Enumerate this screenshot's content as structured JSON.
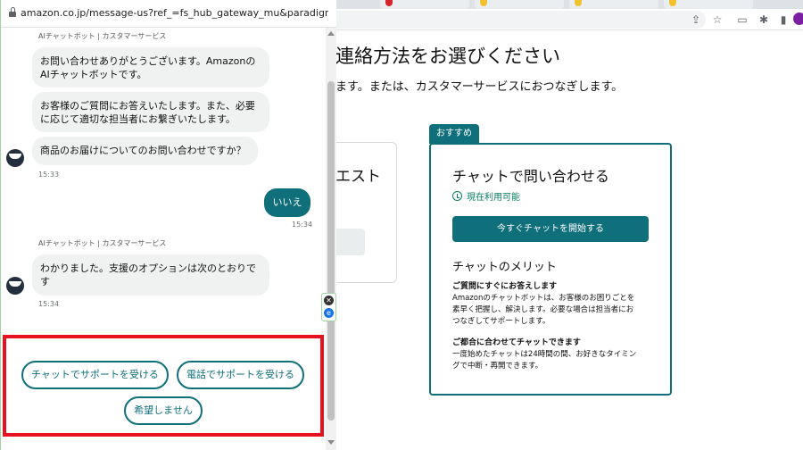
{
  "popup": {
    "url": "amazon.co.jp/message-us?ref_=fs_hub_gateway_mu&paradigm=foresig..."
  },
  "chat": {
    "bot_name": "AIチャットボット | カスタマーサービス",
    "greeting_1": "お問い合わせありがとうございます。Amazonの\nAIチャットボットです。",
    "greeting_2": "お客様のご質問にお答えいたします。また、必要\nに応じて適切な担当者にお繋ぎいたします。",
    "question": "商品のお届けについてのお問い合わせですか？",
    "time_1": "15:33",
    "user_reply": "いいえ",
    "user_time": "15:34",
    "bot_name_2": "AIチャットボット | カスタマーサービス",
    "reply": "わかりました。支援のオプションは次のとおりで\nす",
    "time_2": "15:34",
    "options": [
      "チャットでサポートを受ける",
      "電話でサポートを受ける",
      "希望しません"
    ]
  },
  "background": {
    "heading": "連絡方法をお選びください",
    "sub": "ます。または、カスタマーサービスにおつなぎします。",
    "left_card_title": "エスト",
    "recommend_tag": "おすすめ",
    "chat_card": {
      "title": "チャットで問い合わせる",
      "availability": "現在利用可能",
      "start_button": "今すぐチャットを開始する",
      "merit_title": "チャットのメリット",
      "merit_1_title": "ご質問にすぐにお答えします",
      "merit_1_text": "Amazonのチャットボットは、お客様のお困りごとを\n素早く把握し、解決します。必要な場合は担当者にお\nつなぎしてサポートします。",
      "merit_2_title": "ご都合に合わせてチャットできます",
      "merit_2_text": "一度始めたチャットは24時間の間、お好きなタイミン\nグで中断・再開できます。"
    }
  },
  "colors": {
    "accent": "#0f6f7a",
    "highlight": "#e8121f",
    "available": "#067d62"
  },
  "icons": [
    "lock-icon",
    "clock-icon",
    "share-icon",
    "star-icon",
    "extensions-icon",
    "sidebar-icon",
    "close-icon"
  ]
}
